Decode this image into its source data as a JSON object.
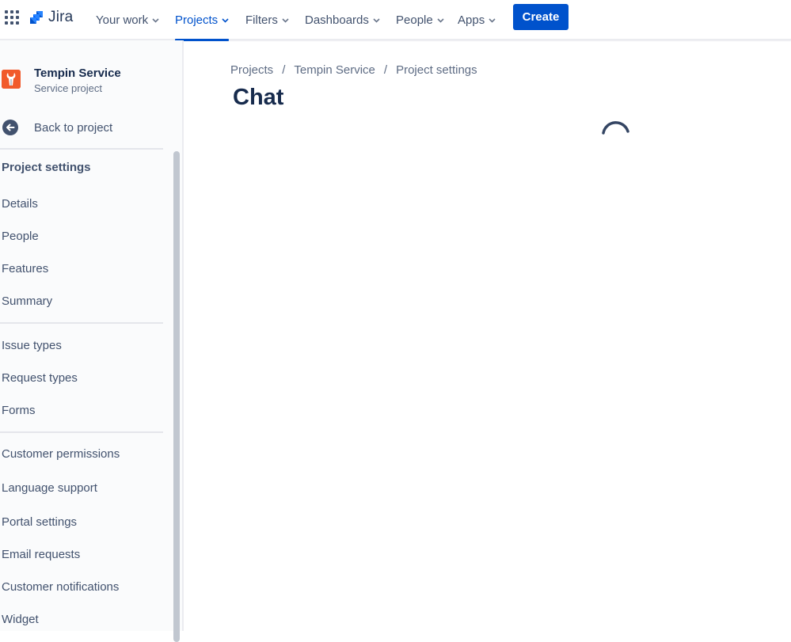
{
  "topnav": {
    "product_name": "Jira",
    "items": [
      {
        "label": "Your work",
        "active": false
      },
      {
        "label": "Projects",
        "active": true
      },
      {
        "label": "Filters",
        "active": false
      },
      {
        "label": "Dashboards",
        "active": false
      },
      {
        "label": "People",
        "active": false
      },
      {
        "label": "Apps",
        "active": false
      }
    ],
    "create_label": "Create",
    "colors": {
      "accent": "#0052cc",
      "text": "#42526e"
    }
  },
  "sidebar": {
    "project": {
      "name": "Tempin Service",
      "type": "Service project",
      "avatar_color": "#f15a2b"
    },
    "back_label": "Back to project",
    "section_title": "Project settings",
    "groups": [
      {
        "items": [
          "Details",
          "People",
          "Features",
          "Summary"
        ]
      },
      {
        "items": [
          "Issue types",
          "Request types",
          "Forms"
        ]
      },
      {
        "items": [
          "Customer permissions",
          "Language support",
          "Portal settings",
          "Email requests",
          "Customer notifications",
          "Widget"
        ]
      }
    ]
  },
  "main": {
    "breadcrumbs": [
      "Projects",
      "Tempin Service",
      "Project settings"
    ],
    "breadcrumb_separator": "/",
    "title": "Chat",
    "loading": true
  }
}
